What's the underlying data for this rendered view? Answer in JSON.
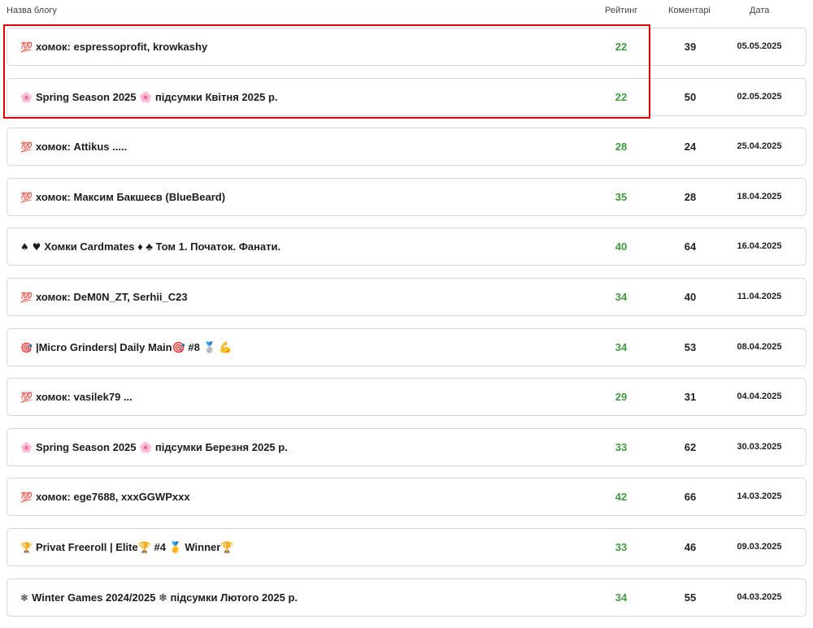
{
  "header": {
    "title_col": "Назва блогу",
    "rating_col": "Рейтинг",
    "comments_col": "Коментарі",
    "date_col": "Дата"
  },
  "colors": {
    "rating": "#3f9a3f",
    "highlight": "#e10000",
    "border": "#d6d6d6"
  },
  "rows": [
    {
      "icon": "💯",
      "title": "хомок: espressoprofit, krowkashy",
      "rating": "22",
      "comments": "39",
      "date": "05.05.2025"
    },
    {
      "icon": "🌸",
      "title": "Spring Season 2025 🌸 підсумки Квітня 2025 р.",
      "rating": "22",
      "comments": "50",
      "date": "02.05.2025"
    },
    {
      "icon": "💯",
      "title": "хомок: Attikus .....",
      "rating": "28",
      "comments": "24",
      "date": "25.04.2025"
    },
    {
      "icon": "💯",
      "title": "хомок: Максим Бакшеєв (BlueBeard)",
      "rating": "35",
      "comments": "28",
      "date": "18.04.2025"
    },
    {
      "icon": "♠ ♥",
      "title": "Хомки Cardmates ♦ ♣ Том 1. Початок. Фанати.",
      "rating": "40",
      "comments": "64",
      "date": "16.04.2025"
    },
    {
      "icon": "💯",
      "title": "хомок: DeM0N_ZT, Serhii_C23",
      "rating": "34",
      "comments": "40",
      "date": "11.04.2025"
    },
    {
      "icon": "🎯",
      "title": "|Micro Grinders| Daily Main🎯 #8 🥈 💪",
      "rating": "34",
      "comments": "53",
      "date": "08.04.2025"
    },
    {
      "icon": "💯",
      "title": "хомок: vasilek79 ...",
      "rating": "29",
      "comments": "31",
      "date": "04.04.2025"
    },
    {
      "icon": "🌸",
      "title": "Spring Season 2025 🌸 підсумки Березня 2025 р.",
      "rating": "33",
      "comments": "62",
      "date": "30.03.2025"
    },
    {
      "icon": "💯",
      "title": "хомок: ege7688, xxxGGWPxxx",
      "rating": "42",
      "comments": "66",
      "date": "14.03.2025"
    },
    {
      "icon": "🏆",
      "title": "Privat Freeroll | Elite🏆 #4 🥇 Winner🏆",
      "rating": "33",
      "comments": "46",
      "date": "09.03.2025"
    },
    {
      "icon": "❄",
      "title": "Winter Games 2024/2025 ❄ підсумки Лютого 2025 р.",
      "rating": "34",
      "comments": "55",
      "date": "04.03.2025"
    }
  ]
}
